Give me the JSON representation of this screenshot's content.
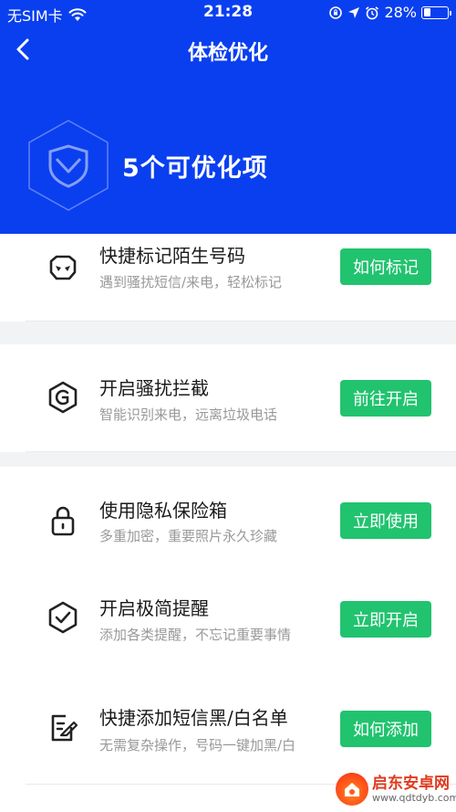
{
  "status": {
    "carrier": "无SIM卡",
    "time": "21:28",
    "battery": "28%",
    "battery_level": 0.28
  },
  "nav": {
    "title": "体检优化"
  },
  "hero": {
    "title": "5个可优化项"
  },
  "items": [
    {
      "title": "快捷标记陌生号码",
      "subtitle": "遇到骚扰短信/来电，轻松标记",
      "button": "如何标记",
      "icon": "mask-icon"
    },
    {
      "title": "开启骚扰拦截",
      "subtitle": "智能识别来电，远离垃圾电话",
      "button": "前往开启",
      "icon": "shield-block-icon"
    },
    {
      "title": "使用隐私保险箱",
      "subtitle": "多重加密，重要照片永久珍藏",
      "button": "立即使用",
      "icon": "lock-icon"
    },
    {
      "title": "开启极简提醒",
      "subtitle": "添加各类提醒，不忘记重要事情",
      "button": "立即开启",
      "icon": "check-shield-icon"
    },
    {
      "title": "快捷添加短信黑/白名单",
      "subtitle": "无需复杂操作，号码一键加黑/白",
      "button": "如何添加",
      "icon": "note-edit-icon"
    }
  ],
  "watermark": {
    "title": "启东安卓网",
    "url": "www.qdtdyb.com"
  },
  "colors": {
    "header": "#0a3ff0",
    "button": "#21c36f",
    "background": "#f2f3f5"
  }
}
